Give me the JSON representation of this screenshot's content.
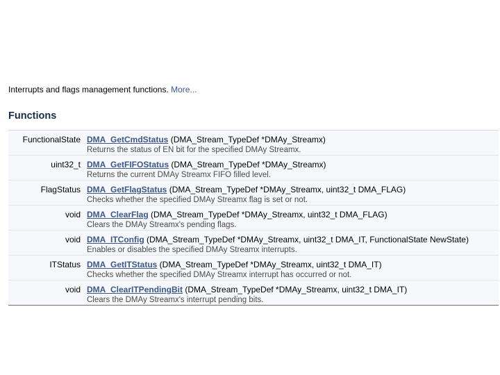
{
  "intro": {
    "text": "Interrupts and flags management functions. ",
    "more_link": "More..."
  },
  "section_title": "Functions",
  "functions": [
    {
      "return_type": "FunctionalState",
      "name": "DMA_GetCmdStatus",
      "params": " (DMA_Stream_TypeDef *DMAy_Streamx)",
      "description": "Returns the status of EN bit for the specified DMAy Streamx."
    },
    {
      "return_type": "uint32_t",
      "name": "DMA_GetFIFOStatus",
      "params": " (DMA_Stream_TypeDef *DMAy_Streamx)",
      "description": "Returns the current DMAy Streamx FIFO filled level."
    },
    {
      "return_type": "FlagStatus",
      "name": "DMA_GetFlagStatus",
      "params": " (DMA_Stream_TypeDef *DMAy_Streamx, uint32_t DMA_FLAG)",
      "description": "Checks whether the specified DMAy Streamx flag is set or not."
    },
    {
      "return_type": "void",
      "name": "DMA_ClearFlag",
      "params": " (DMA_Stream_TypeDef *DMAy_Streamx, uint32_t DMA_FLAG)",
      "description": "Clears the DMAy Streamx's pending flags."
    },
    {
      "return_type": "void",
      "name": "DMA_ITConfig",
      "params": " (DMA_Stream_TypeDef *DMAy_Streamx, uint32_t DMA_IT, FunctionalState NewState)",
      "description": "Enables or disables the specified DMAy Streamx interrupts."
    },
    {
      "return_type": "ITStatus",
      "name": "DMA_GetITStatus",
      "params": " (DMA_Stream_TypeDef *DMAy_Streamx, uint32_t DMA_IT)",
      "description": "Checks whether the specified DMAy Streamx interrupt has occurred or not."
    },
    {
      "return_type": "void",
      "name": "DMA_ClearITPendingBit",
      "params": " (DMA_Stream_TypeDef *DMAy_Streamx, uint32_t DMA_IT)",
      "description": "Clears the DMAy Streamx's interrupt pending bits."
    }
  ],
  "colors": {
    "link": "#3d578c",
    "row_background": "#f7f8fb",
    "row_separator": "#dfe3ec"
  }
}
